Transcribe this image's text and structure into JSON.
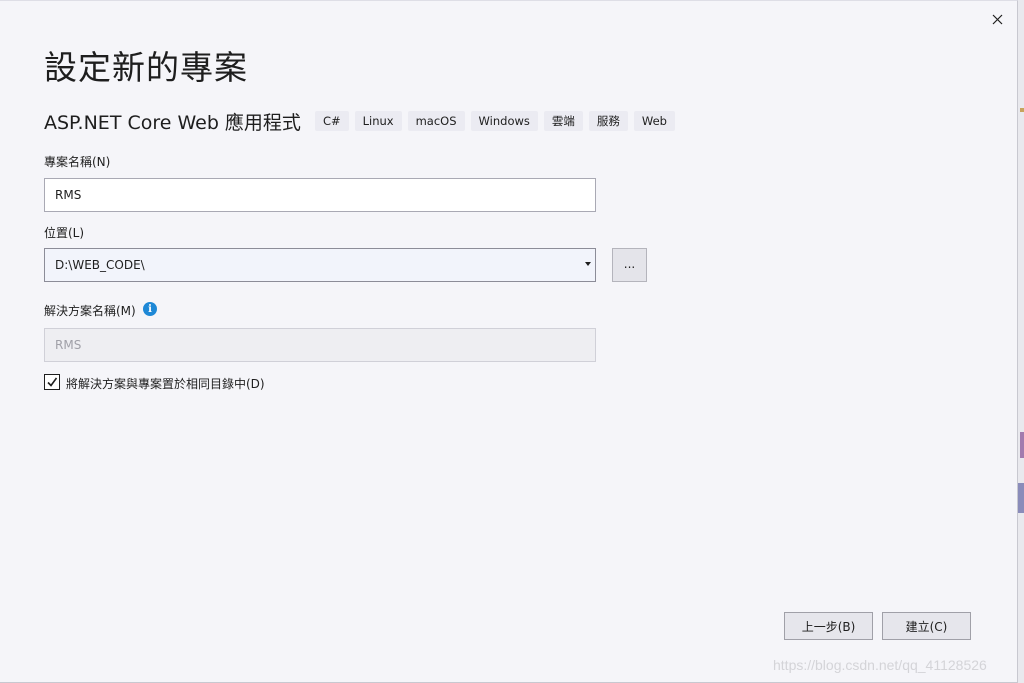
{
  "dialog": {
    "title": "設定新的專案",
    "close_icon": "close-icon"
  },
  "template": {
    "name": "ASP.NET Core Web 應用程式",
    "tags": [
      "C#",
      "Linux",
      "macOS",
      "Windows",
      "雲端",
      "服務",
      "Web"
    ]
  },
  "project_name": {
    "label": "專案名稱(N)",
    "value": "RMS"
  },
  "location": {
    "label": "位置(L)",
    "value": "D:\\WEB_CODE\\",
    "browse_label": "..."
  },
  "solution_name": {
    "label": "解決方案名稱(M)",
    "value": "RMS",
    "info_icon": "info-icon",
    "info_glyph": "i"
  },
  "same_dir": {
    "label": "將解決方案與專案置於相同目錄中(D)",
    "checked": true
  },
  "footer": {
    "back_label": "上一步(B)",
    "create_label": "建立(C)"
  },
  "watermark": "https://blog.csdn.net/qq_41128526"
}
